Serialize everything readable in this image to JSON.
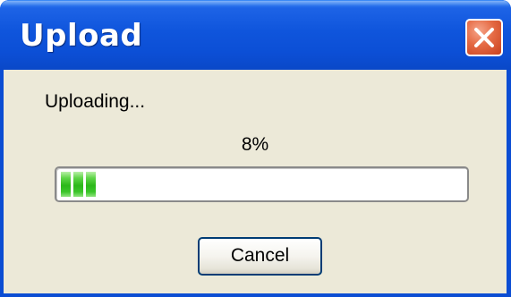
{
  "window": {
    "title": "Upload",
    "close_icon": "close-x-icon",
    "accent_color": "#0a4fd8",
    "close_color": "#e56a44"
  },
  "dialog": {
    "status_text": "Uploading...",
    "percent_text": "8%",
    "progress_fraction": 0.08,
    "progress_color": "#2cb81a",
    "cancel_label": "Cancel"
  }
}
